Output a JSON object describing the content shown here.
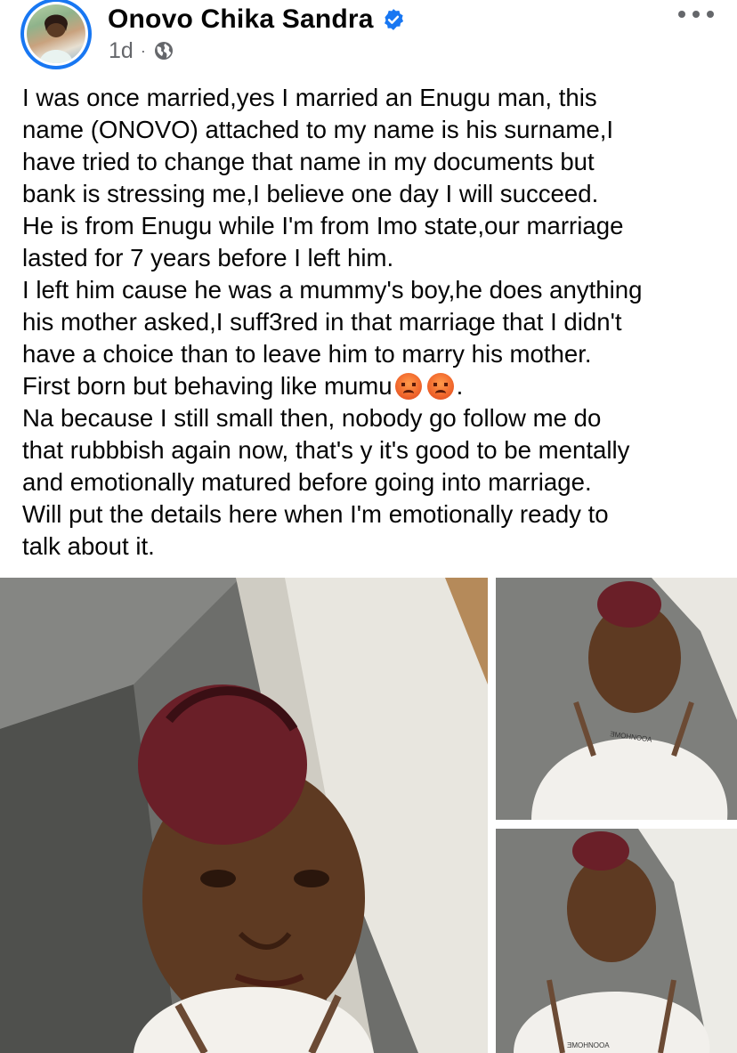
{
  "post": {
    "author": "Onovo Chika Sandra",
    "time": "1d",
    "separator": "·",
    "lines": [
      "I was once married,yes I married an Enugu man, this",
      "name (ONOVO) attached to my name is his surname,I",
      "have tried to change that name in my documents but",
      "bank is stressing me,I believe one day I will succeed.",
      "He is from Enugu while I'm from Imo state,our marriage",
      "lasted for 7 years before I left him.",
      "I left him cause he was a mummy's boy,he does anything",
      "his mother asked,I suff3red in that marriage that I didn't",
      "have a choice than to leave him to marry his mother.",
      "First born but behaving like mumu",
      "Na because I still small then, nobody go follow me do",
      "that rubbbish again now, that's y it's good to be mentally",
      "and emotionally matured before going into marriage.",
      "Will put the details here when I'm emotionally ready to",
      "talk about it."
    ],
    "line10_suffix": "."
  },
  "photos": {
    "tshirt_text": "ƎMOHNOOA"
  },
  "icons": {
    "verified": "verified-badge-icon",
    "privacy": "globe-icon",
    "more": "more-options-icon",
    "emoji": "pouting-face-emoji"
  },
  "colors": {
    "accent": "#1877f2",
    "meta_text": "#65676b",
    "text": "#050505"
  }
}
